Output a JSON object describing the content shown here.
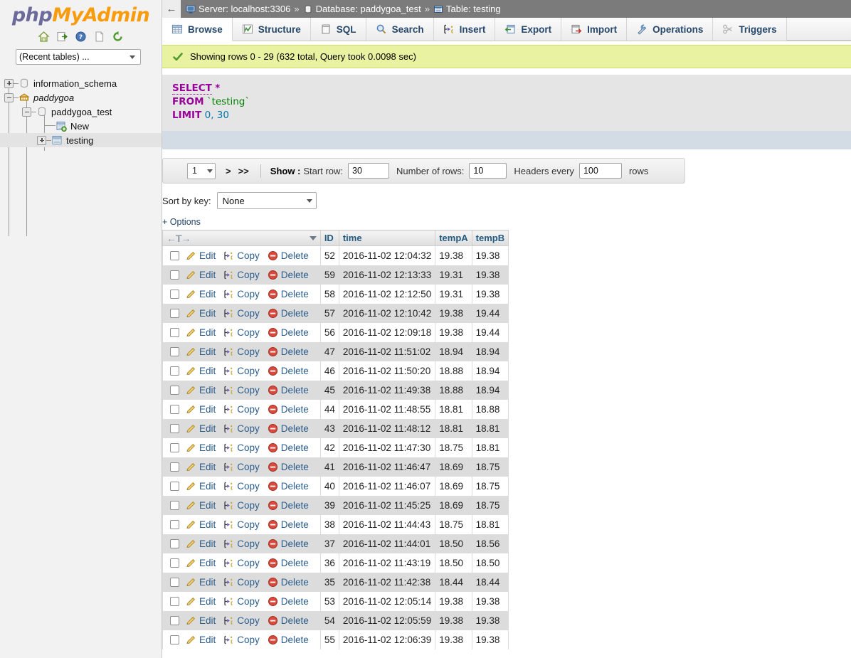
{
  "sidebar": {
    "logo": {
      "php": "php",
      "my": "My",
      "admin": "Admin"
    },
    "icons": [
      {
        "name": "home-icon",
        "title": "Home"
      },
      {
        "name": "export-icon",
        "title": "Export"
      },
      {
        "name": "help-icon",
        "title": "Documentation"
      },
      {
        "name": "docs-icon",
        "title": "phpMyAdmin documentation"
      },
      {
        "name": "refresh-icon",
        "title": "Reload navigation"
      }
    ],
    "recent_select": {
      "value": "(Recent tables) ...",
      "caret": "chevron-down-icon"
    },
    "tree": [
      {
        "label": "information_schema",
        "icon": "database-icon",
        "toggle": "plus",
        "depth": 0,
        "italic": false,
        "selected": false
      },
      {
        "label": "paddygoa",
        "icon": "server-icon",
        "toggle": "minus",
        "depth": 0,
        "italic": true,
        "selected": false
      },
      {
        "label": "paddygoa_test",
        "icon": "database-icon",
        "toggle": "minus",
        "depth": 1,
        "italic": false,
        "selected": false
      },
      {
        "label": "New",
        "icon": "new-table-icon",
        "toggle": "none",
        "depth": 2,
        "italic": false,
        "selected": false
      },
      {
        "label": "testing",
        "icon": "table-icon",
        "toggle": "plus",
        "depth": 2,
        "italic": false,
        "selected": true
      }
    ]
  },
  "breadcrumb": {
    "back_label": "←",
    "items": [
      {
        "icon": "server-icon",
        "text": "Server: localhost:3306"
      },
      {
        "icon": "database-icon",
        "text": "Database: paddygoa_test"
      },
      {
        "icon": "table-icon",
        "text": "Table: testing"
      }
    ],
    "separator": "»"
  },
  "tabs": [
    {
      "label": "Browse",
      "icon": "browse-icon",
      "active": true
    },
    {
      "label": "Structure",
      "icon": "structure-icon",
      "active": false
    },
    {
      "label": "SQL",
      "icon": "sql-icon",
      "active": false
    },
    {
      "label": "Search",
      "icon": "search-icon",
      "active": false
    },
    {
      "label": "Insert",
      "icon": "insert-icon",
      "active": false
    },
    {
      "label": "Export",
      "icon": "export-icon",
      "active": false
    },
    {
      "label": "Import",
      "icon": "import-icon",
      "active": false
    },
    {
      "label": "Operations",
      "icon": "operations-icon",
      "active": false
    },
    {
      "label": "Triggers",
      "icon": "triggers-icon",
      "active": false
    }
  ],
  "notice": {
    "icon": "success-check-icon",
    "text": "Showing rows 0 - 29 (632 total, Query took 0.0098 sec)"
  },
  "sql": {
    "line1_kw": "SELECT",
    "line1_star": "*",
    "line2_kw": "FROM",
    "line2_table": "`testing`",
    "line3_kw": "LIMIT",
    "line3_a": "0",
    "line3_comma": ",",
    "line3_b": "30"
  },
  "pager": {
    "page_value": "1",
    "next_label": ">",
    "last_label": ">>",
    "show_label": "Show :",
    "start_row_label": "Start row:",
    "start_row_value": "30",
    "number_rows_label": "Number of rows:",
    "number_rows_value": "10",
    "headers_every_label": "Headers every",
    "headers_every_value": "100",
    "rows_label": "rows"
  },
  "sort": {
    "label": "Sort by key:",
    "value": "None"
  },
  "options_link": "+ Options",
  "table": {
    "sort_header": "←T→",
    "columns": [
      "ID",
      "time",
      "tempA",
      "tempB"
    ],
    "actions": {
      "edit": "Edit",
      "copy": "Copy",
      "delete": "Delete"
    },
    "rows": [
      {
        "id": "52",
        "time": "2016-11-02 12:04:32",
        "tempA": "19.38",
        "tempB": "19.38"
      },
      {
        "id": "59",
        "time": "2016-11-02 12:13:33",
        "tempA": "19.31",
        "tempB": "19.38"
      },
      {
        "id": "58",
        "time": "2016-11-02 12:12:50",
        "tempA": "19.31",
        "tempB": "19.38"
      },
      {
        "id": "57",
        "time": "2016-11-02 12:10:42",
        "tempA": "19.38",
        "tempB": "19.44"
      },
      {
        "id": "56",
        "time": "2016-11-02 12:09:18",
        "tempA": "19.38",
        "tempB": "19.44"
      },
      {
        "id": "47",
        "time": "2016-11-02 11:51:02",
        "tempA": "18.94",
        "tempB": "18.94"
      },
      {
        "id": "46",
        "time": "2016-11-02 11:50:20",
        "tempA": "18.88",
        "tempB": "18.94"
      },
      {
        "id": "45",
        "time": "2016-11-02 11:49:38",
        "tempA": "18.88",
        "tempB": "18.94"
      },
      {
        "id": "44",
        "time": "2016-11-02 11:48:55",
        "tempA": "18.81",
        "tempB": "18.88"
      },
      {
        "id": "43",
        "time": "2016-11-02 11:48:12",
        "tempA": "18.81",
        "tempB": "18.81"
      },
      {
        "id": "42",
        "time": "2016-11-02 11:47:30",
        "tempA": "18.75",
        "tempB": "18.81"
      },
      {
        "id": "41",
        "time": "2016-11-02 11:46:47",
        "tempA": "18.69",
        "tempB": "18.75"
      },
      {
        "id": "40",
        "time": "2016-11-02 11:46:07",
        "tempA": "18.69",
        "tempB": "18.75"
      },
      {
        "id": "39",
        "time": "2016-11-02 11:45:25",
        "tempA": "18.69",
        "tempB": "18.75"
      },
      {
        "id": "38",
        "time": "2016-11-02 11:44:43",
        "tempA": "18.75",
        "tempB": "18.81"
      },
      {
        "id": "37",
        "time": "2016-11-02 11:44:01",
        "tempA": "18.50",
        "tempB": "18.56"
      },
      {
        "id": "36",
        "time": "2016-11-02 11:43:19",
        "tempA": "18.50",
        "tempB": "18.50"
      },
      {
        "id": "35",
        "time": "2016-11-02 11:42:38",
        "tempA": "18.44",
        "tempB": "18.44"
      },
      {
        "id": "53",
        "time": "2016-11-02 12:05:14",
        "tempA": "19.38",
        "tempB": "19.38"
      },
      {
        "id": "54",
        "time": "2016-11-02 12:05:59",
        "tempA": "19.38",
        "tempB": "19.38"
      },
      {
        "id": "55",
        "time": "2016-11-02 12:06:39",
        "tempA": "19.38",
        "tempB": "19.38"
      }
    ]
  },
  "colors": {
    "breadcrumb_bg": "#7b7b7b",
    "notice_bg": "#e8f2a1",
    "sql_bg": "#e5e5e5",
    "sql_footer_bg": "#d3dce4",
    "tab_text": "#25476a",
    "header_text": "#235a81",
    "link": "#2b5d8c",
    "logo_purple": "#6c6a9b",
    "logo_orange": "#f89c0e"
  }
}
